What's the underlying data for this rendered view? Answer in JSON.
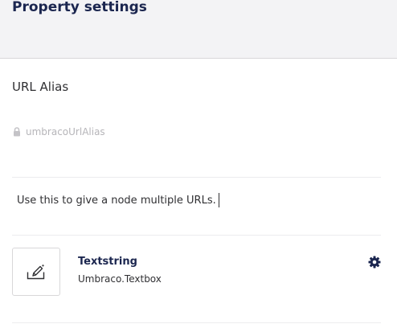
{
  "header": {
    "title": "Property settings"
  },
  "property": {
    "name": "URL Alias",
    "alias": "umbracoUrlAlias",
    "description": "Use this to give a node multiple URLs."
  },
  "editor": {
    "name": "Textstring",
    "alias": "Umbraco.Textbox",
    "icon": "edit-icon"
  },
  "icons": {
    "alias_lock": "lock-icon",
    "editor_settings": "gear-icon"
  }
}
